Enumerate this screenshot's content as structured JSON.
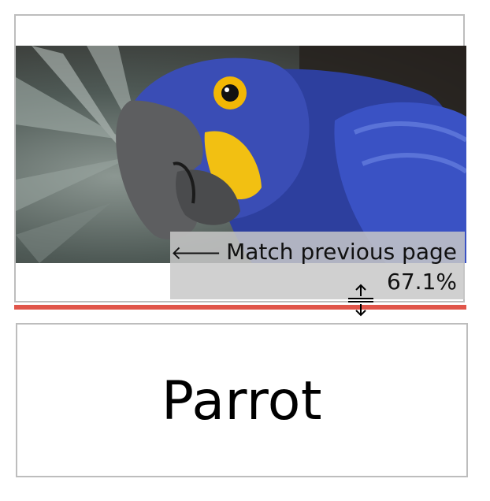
{
  "previous_page": {
    "image_subject": "blue macaw parrot photo"
  },
  "overlay": {
    "match_label": "Match previous page",
    "percent": "67.1%",
    "icon": "arrow-left-icon"
  },
  "divider": {
    "color": "#e0554a"
  },
  "resize_handle": {
    "icon": "resize-vertical-icon"
  },
  "current_page": {
    "title": "Parrot"
  }
}
